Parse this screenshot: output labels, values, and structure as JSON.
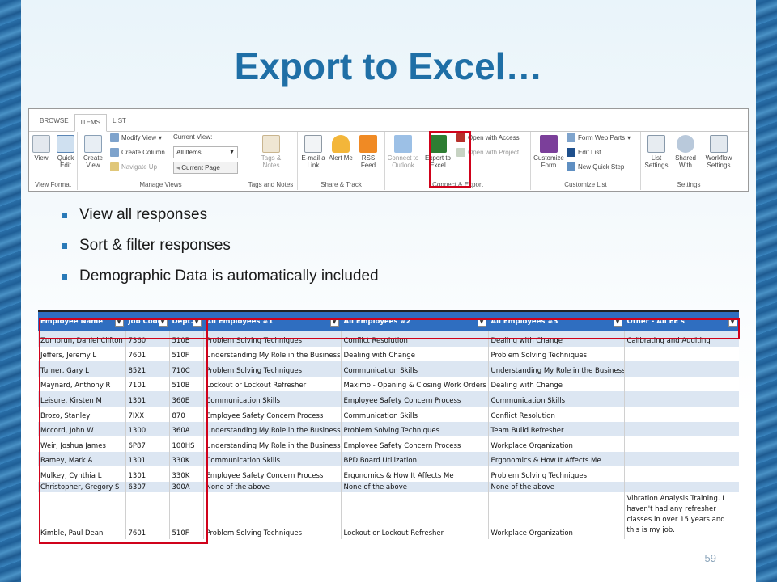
{
  "slide": {
    "title": "Export to Excel…",
    "page_number": "59"
  },
  "ribbon": {
    "tabs": [
      "BROWSE",
      "ITEMS",
      "LIST"
    ],
    "active_tab": "LIST",
    "groups": {
      "view_format": {
        "label": "View Format",
        "view": "View",
        "quick_edit": "Quick Edit"
      },
      "manage_views": {
        "label": "Manage Views",
        "create_view": "Create View",
        "modify_view": "Modify View",
        "create_column": "Create Column",
        "navigate_up": "Navigate Up",
        "current_view_label": "Current View:",
        "current_view_value": "All Items",
        "current_page": "Current Page"
      },
      "tags_notes": {
        "label": "Tags and Notes",
        "tags_notes": "Tags & Notes"
      },
      "share_track": {
        "label": "Share & Track",
        "email_link": "E-mail a Link",
        "alert_me": "Alert Me",
        "rss_feed": "RSS Feed"
      },
      "connect_export": {
        "label": "Connect & Export",
        "connect_outlook": "Connect to Outlook",
        "export_excel": "Export to Excel",
        "open_access": "Open with Access",
        "open_project": "Open with Project"
      },
      "customize_list": {
        "label": "Customize List",
        "customize_form": "Customize Form",
        "form_web_parts": "Form Web Parts",
        "edit_list": "Edit List",
        "new_quick_step": "New Quick Step"
      },
      "settings": {
        "label": "Settings",
        "list_settings": "List Settings",
        "shared_with": "Shared With",
        "workflow_settings": "Workflow Settings"
      }
    }
  },
  "bullets": [
    "View all responses",
    "Sort & filter responses",
    "Demographic Data is automatically included"
  ],
  "sheet": {
    "headers": [
      "Employee Name",
      "Job Code",
      "Dept.",
      "All Employees #1",
      "All Employees #2",
      "All Employees #3",
      "Other - All EE's"
    ],
    "rows": [
      [
        "Zumbrun, Daniel Clifton",
        "7360",
        "510B",
        "Problem Solving Techniques",
        "Conflict Resolution",
        "Dealing with Change",
        "Calibrating and Auditing"
      ],
      [
        "Jeffers, Jeremy L",
        "7601",
        "510F",
        "Understanding My Role in the Business",
        "Dealing with Change",
        "Problem Solving Techniques",
        ""
      ],
      [
        "Turner, Gary L",
        "8521",
        "710C",
        "Problem Solving Techniques",
        "Communication Skills",
        "Understanding My Role in the Business",
        ""
      ],
      [
        "Maynard, Anthony R",
        "7101",
        "510B",
        "Lockout or Lockout Refresher",
        "Maximo - Opening & Closing Work Orders",
        "Dealing with Change",
        ""
      ],
      [
        "Leisure, Kirsten M",
        "1301",
        "360E",
        "Communication Skills",
        "Employee Safety Concern Process",
        "Communication Skills",
        ""
      ],
      [
        "Brozo, Stanley",
        "7IXX",
        "870",
        "Employee Safety Concern Process",
        "Communication Skills",
        "Conflict Resolution",
        ""
      ],
      [
        "Mccord, John W",
        "1300",
        "360A",
        "Understanding My Role in the Business",
        "Problem Solving Techniques",
        "Team Build Refresher",
        ""
      ],
      [
        "Weir, Joshua James",
        "6P87",
        "100HS",
        "Understanding My Role in the Business",
        "Employee Safety Concern Process",
        "Workplace Organization",
        ""
      ],
      [
        "Ramey, Mark A",
        "1301",
        "330K",
        "Communication Skills",
        "BPD Board Utilization",
        "Ergonomics & How It Affects Me",
        ""
      ],
      [
        "Mulkey, Cynthia L",
        "1301",
        "330K",
        "Employee Safety Concern Process",
        "Ergonomics & How It Affects Me",
        "Problem Solving Techniques",
        ""
      ],
      [
        "Christopher, Gregory S",
        "6307",
        "300A",
        "None of the above",
        "None of the above",
        "None of the above",
        ""
      ],
      [
        "Kimble, Paul Dean",
        "7601",
        "510F",
        "Problem Solving Techniques",
        "Lockout or Lockout Refresher",
        "Workplace Organization",
        "Vibration Analysis Training. I haven't had any refresher classes in over 15 years and this is my job."
      ]
    ]
  },
  "colors": {
    "title": "#1f6fa6",
    "header_fill": "#2f6ec0",
    "band_fill": "#dce6f2",
    "highlight": "#d0021b",
    "bullet": "#2a7ab8"
  }
}
